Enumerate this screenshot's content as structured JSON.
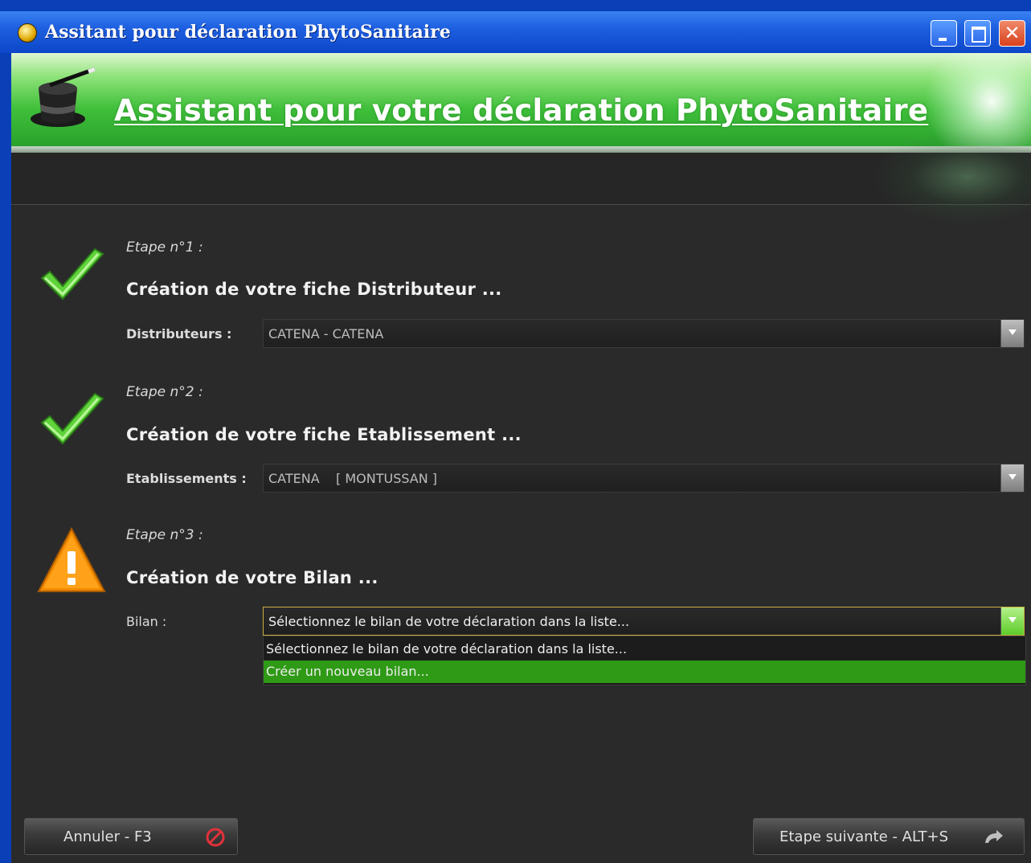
{
  "window": {
    "title": "Assitant pour déclaration PhytoSanitaire",
    "controls": [
      "minimize",
      "maximize",
      "close"
    ]
  },
  "banner": {
    "title": "Assistant pour votre déclaration PhytoSanitaire",
    "icon": "magic-hat-icon"
  },
  "steps": [
    {
      "label": "Etape n°1 :",
      "title": "Création de votre fiche Distributeur ...",
      "status_icon": "checkmark-icon",
      "field_label": "Distributeurs :",
      "field_value": "CATENA - CATENA"
    },
    {
      "label": "Etape n°2 :",
      "title": "Création de votre fiche Etablissement ...",
      "status_icon": "checkmark-icon",
      "field_label": "Etablissements :",
      "field_value": "CATENA    [ MONTUSSAN ]"
    },
    {
      "label": "Etape n°3 :",
      "title": "Création de votre Bilan ...",
      "status_icon": "warning-icon",
      "field_label": "Bilan :",
      "field_value": "Sélectionnez le bilan de votre déclaration dans la liste...",
      "options": [
        "Sélectionnez le bilan de votre déclaration dans la liste...",
        "Créer un nouveau bilan..."
      ],
      "highlighted_option": "Créer un nouveau bilan..."
    }
  ],
  "buttons": {
    "cancel": "Annuler - F3",
    "next": "Etape suivante - ALT+S"
  },
  "colors": {
    "titlebar": "#0c47c8",
    "banner": "#3fbf3a",
    "background": "#2a2a2a",
    "selection": "#2e9a15",
    "warning": "#f08a00"
  }
}
